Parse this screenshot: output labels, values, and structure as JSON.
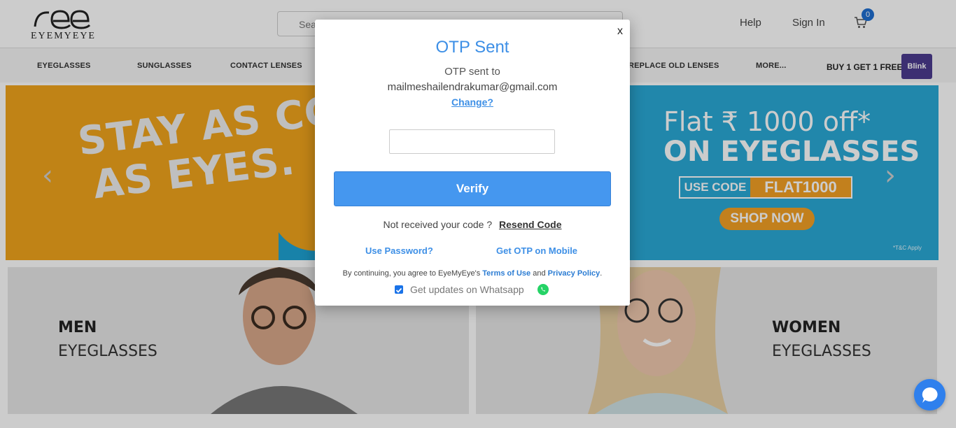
{
  "header": {
    "logo_text": "EYEMYEYE",
    "search_placeholder": "Sea",
    "help": "Help",
    "sign_in": "Sign In",
    "cart_count": "0"
  },
  "nav": {
    "items": [
      "EYEGLASSES",
      "SUNGLASSES",
      "CONTACT LENSES",
      "REPLACE OLD LENSES",
      "MORE..."
    ],
    "promo_text": "BUY 1 GET 1 FREE",
    "promo_brand": "Blink"
  },
  "banner": {
    "left_line1": "STAY AS COO",
    "left_line2": "AS EYES.",
    "right_title": "Flat ₹ 1000 off*",
    "right_sub": "ON EYEGLASSES",
    "code_label": "USE CODE",
    "code_value": "FLAT1000",
    "cta": "SHOP NOW",
    "terms": "*T&C Apply",
    "prev_icon": "‹",
    "next_icon": "›"
  },
  "tiles": {
    "men_title": "MEN",
    "men_sub": "EYEGLASSES",
    "women_title": "WOMEN",
    "women_sub": "EYEGLASSES"
  },
  "modal": {
    "close": "x",
    "title": "OTP Sent",
    "sent_text": "OTP sent to",
    "email": "mailmeshailendrakumar@gmail.com",
    "change": "Change?",
    "verify": "Verify",
    "not_received": "Not received your code ?",
    "resend": "Resend Code",
    "use_password": "Use Password?",
    "otp_mobile": "Get OTP on Mobile",
    "terms_prefix": "By continuing, you agree to EyeMyEye's",
    "terms_link": "Terms of Use",
    "terms_and": "and",
    "privacy_link": "Privacy Policy",
    "terms_end": ".",
    "whatsapp_label": "Get updates on Whatsapp",
    "whatsapp_checked": true
  },
  "colors": {
    "accent": "#3d8fe6",
    "verify_bg": "#4597ef",
    "banner_left": "#f1a41c",
    "banner_right": "#2aa9d6"
  }
}
